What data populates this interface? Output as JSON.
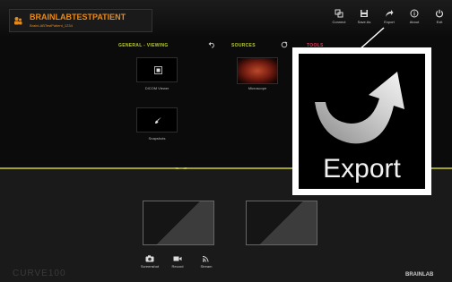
{
  "patient": {
    "name": "BRAINLABTESTPATIENT",
    "id": "BrainLABTestPatient_1234"
  },
  "toolbar": [
    {
      "label": "Connect",
      "icon": "connect-icon"
    },
    {
      "label": "Save As",
      "icon": "save-as-icon"
    },
    {
      "label": "Export",
      "icon": "export-icon"
    },
    {
      "label": "About",
      "icon": "info-icon"
    },
    {
      "label": "Exit",
      "icon": "power-icon"
    }
  ],
  "sections": {
    "general_viewing": "GENERAL - VIEWING",
    "sources": "SOURCES",
    "tools": "TOOLS"
  },
  "apps": [
    {
      "label": "DICOM Viewer",
      "icon": "dicom-viewer-icon"
    },
    {
      "label": "Microscope",
      "icon": "microscope-image"
    },
    {
      "label": "Snapshots",
      "icon": "brush-icon"
    }
  ],
  "bottom_buttons": [
    {
      "label": "Screenshot",
      "icon": "camera-icon"
    },
    {
      "label": "Record",
      "icon": "video-camera-icon"
    },
    {
      "label": "Stream",
      "icon": "stream-icon"
    }
  ],
  "branding": {
    "product": "CURVE100",
    "company": "BRAINLAB"
  },
  "callout": {
    "label": "Export"
  },
  "colors": {
    "accent_orange": "#e58a1f",
    "section_green": "#b7c83a",
    "section_red": "#d43a5c",
    "divider": "#a0a030"
  }
}
